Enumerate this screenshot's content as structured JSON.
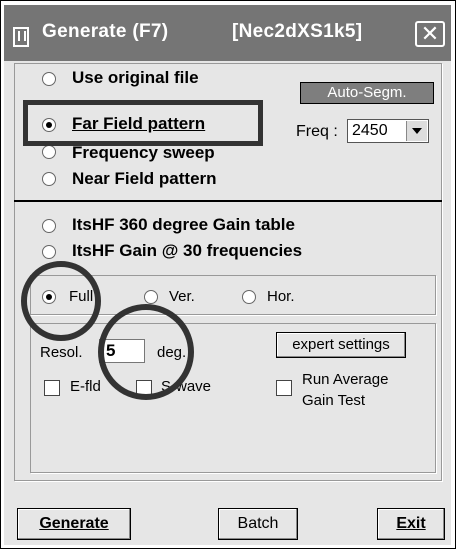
{
  "title": {
    "app": "Generate (F7)",
    "project": "[Nec2dXS1k5]"
  },
  "close_glyph": "✕",
  "options": [
    {
      "key": "use_original",
      "label": "Use original file",
      "selected": false
    },
    {
      "key": "far_field",
      "label": "Far Field pattern",
      "selected": true
    },
    {
      "key": "freq_sweep",
      "label": "Frequency sweep",
      "selected": false
    },
    {
      "key": "near_field",
      "label": "Near Field pattern",
      "selected": false
    },
    {
      "key": "itshf_360",
      "label": "ItsHF 360 degree Gain table",
      "selected": false
    },
    {
      "key": "itshf_30",
      "label": "ItsHF Gain @ 30 frequencies",
      "selected": false
    }
  ],
  "auto_segm": "Auto-Segm.",
  "freq": {
    "label": "Freq :",
    "value": "2450"
  },
  "pattern": [
    {
      "label": "Full",
      "selected": true
    },
    {
      "label": "Ver.",
      "selected": false
    },
    {
      "label": "Hor.",
      "selected": false
    }
  ],
  "resol": {
    "label": "Resol.",
    "value": "5",
    "unit": "deg."
  },
  "expert_settings": "expert settings",
  "checks": {
    "efld": "E-fld",
    "swave": "S-wave",
    "avg_line1": "Run Average",
    "avg_line2": "Gain Test"
  },
  "buttons": {
    "generate": "Generate",
    "batch": "Batch",
    "exit": "Exit"
  }
}
